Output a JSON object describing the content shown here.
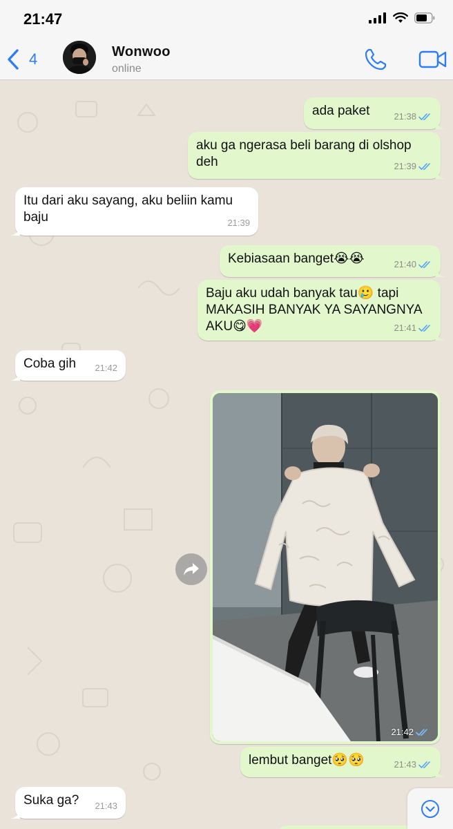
{
  "status_bar": {
    "time": "21:47"
  },
  "header": {
    "back_count": "4",
    "contact_name": "Wonwoo",
    "contact_status": "online"
  },
  "messages": [
    {
      "dir": "out",
      "text": "ada paket",
      "time": "21:38",
      "read": true
    },
    {
      "dir": "out",
      "text": "aku ga ngerasa beli barang di olshop deh",
      "time": "21:39",
      "read": true
    },
    {
      "dir": "in",
      "text": "Itu dari aku sayang, aku beliin kamu baju",
      "time": "21:39"
    },
    {
      "dir": "out",
      "text": "Kebiasaan banget😭😭",
      "time": "21:40",
      "read": true
    },
    {
      "dir": "out",
      "text": "Baju aku udah banyak tau🥲 tapi MAKASIH BANYAK YA SAYANGNYA AKU😋💗",
      "time": "21:41",
      "read": true
    },
    {
      "dir": "in",
      "text": "Coba gih",
      "time": "21:42"
    },
    {
      "dir": "out",
      "type": "photo",
      "time": "21:42",
      "read": true
    },
    {
      "dir": "out",
      "text": "lembut banget🥺🥺",
      "time": "21:43",
      "read": true
    },
    {
      "dir": "in",
      "text": "Suka ga?",
      "time": "21:43"
    }
  ],
  "colors": {
    "accent": "#2b7cf6",
    "outgoing_bubble": "#e2f7cb",
    "incoming_bubble": "#ffffff",
    "chat_background": "#e9e3da",
    "read_ticks": "#4fa3f7"
  },
  "icons": {
    "back": "chevron-left-icon",
    "call": "phone-icon",
    "video": "video-camera-icon",
    "forward": "forward-arrow-icon",
    "scroll_down": "chevron-down-circle-icon",
    "signal": "cellular-signal-icon",
    "wifi": "wifi-icon",
    "battery": "battery-icon"
  }
}
